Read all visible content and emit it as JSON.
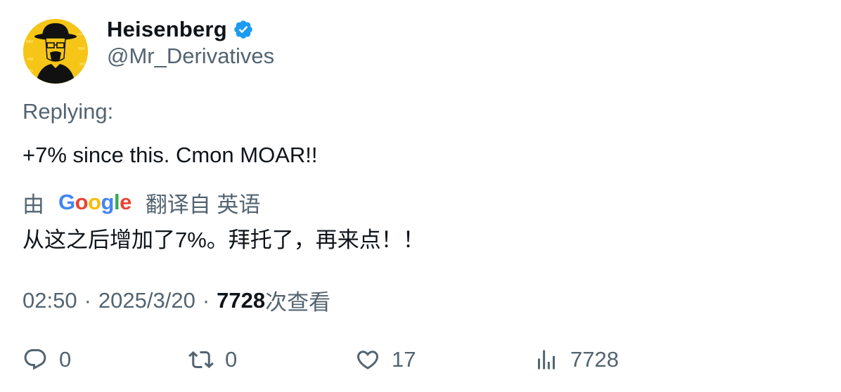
{
  "author": {
    "display_name": "Heisenberg",
    "handle": "@Mr_Derivatives",
    "verified": true,
    "verified_color": "#1d9bf0"
  },
  "tweet": {
    "replying_label": "Replying:",
    "text": "+7% since this. Cmon MOAR!!",
    "translation": {
      "prefix": "由",
      "provider": "Google",
      "suffix": "翻译自 英语",
      "text": "从这之后增加了7%。拜托了，再来点！！"
    },
    "time": "02:50",
    "separator": "·",
    "date": "2025/3/20",
    "views_count": "7728",
    "views_label": "次查看"
  },
  "actions": {
    "reply": {
      "icon": "reply-icon",
      "count": "0"
    },
    "retweet": {
      "icon": "retweet-icon",
      "count": "0"
    },
    "like": {
      "icon": "heart-icon",
      "count": "17"
    },
    "views": {
      "icon": "analytics-icon",
      "count": "7728"
    }
  },
  "colors": {
    "text_primary": "#0f1419",
    "text_secondary": "#536471",
    "avatar_background": "#f5c518"
  }
}
